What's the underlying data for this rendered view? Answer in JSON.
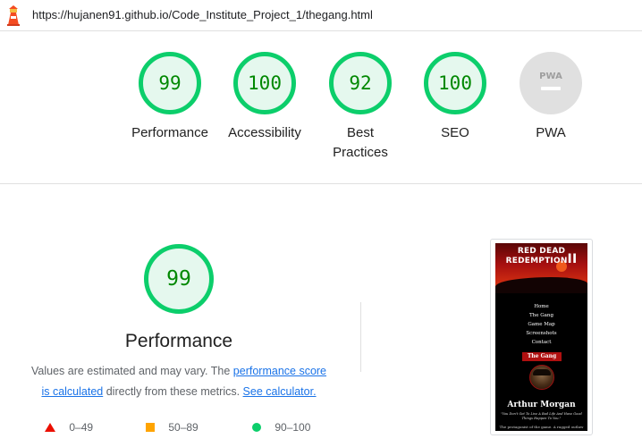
{
  "browser": {
    "url": "https://hujanen91.github.io/Code_Institute_Project_1/thegang.html",
    "logo_icon": "lighthouse-icon"
  },
  "categories": [
    {
      "score": "99",
      "label": "Performance"
    },
    {
      "score": "100",
      "label": "Accessibility"
    },
    {
      "score": "92",
      "label": "Best Practices"
    },
    {
      "score": "100",
      "label": "SEO"
    },
    {
      "score": "PWA",
      "label": "PWA"
    }
  ],
  "performance": {
    "score": "99",
    "title": "Performance",
    "desc_text1": "Values are estimated and may vary. The ",
    "desc_link1a": "performance score",
    "desc_link1b": "is calculated",
    "desc_text2": " directly from these metrics. ",
    "desc_link2": "See calculator.",
    "legend": [
      {
        "range": "0–49",
        "icon": "fail-triangle-icon",
        "color": "#eb0f00"
      },
      {
        "range": "50–89",
        "icon": "average-square-icon",
        "color": "#ffa400"
      },
      {
        "range": "90–100",
        "icon": "pass-circle-icon",
        "color": "#0cce6b"
      }
    ]
  },
  "screenshot": {
    "title_line1": "RED DEAD",
    "title_line2": "REDEMPTION",
    "title_numeral": "II",
    "nav": [
      "Home",
      "The Gang",
      "Game Map",
      "Screenshots",
      "Contact"
    ],
    "section_badge": "The Gang",
    "character_name": "Arthur Morgan",
    "quote": "\"You Don't Get To Live A Bad Life And Have Good Things Happen To You.\"",
    "caption": "The protagonist of the game. A rugged outlaw"
  },
  "colors": {
    "pass": "#0cce6b",
    "pass_text": "#008800",
    "link": "#1a73e8",
    "neutral": "#e0e0e0"
  }
}
